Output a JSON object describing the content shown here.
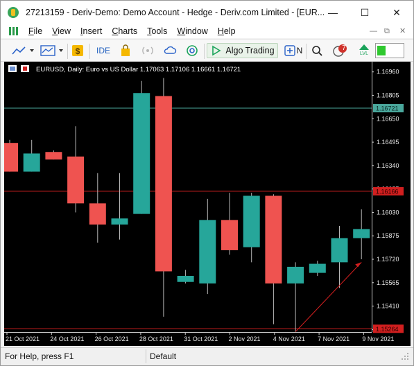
{
  "window": {
    "title": "27213159 - Deriv-Demo: Demo Account - Hedge - Deriv.com Limited - [EUR...",
    "minimize_glyph": "—",
    "maximize_glyph": "☐",
    "close_glyph": "✕"
  },
  "menu": {
    "items": [
      {
        "pre": "",
        "accel": "F",
        "post": "ile"
      },
      {
        "pre": "",
        "accel": "V",
        "post": "iew"
      },
      {
        "pre": "",
        "accel": "I",
        "post": "nsert"
      },
      {
        "pre": "",
        "accel": "C",
        "post": "harts"
      },
      {
        "pre": "",
        "accel": "T",
        "post": "ools"
      },
      {
        "pre": "",
        "accel": "W",
        "post": "indow"
      },
      {
        "pre": "",
        "accel": "H",
        "post": "elp"
      }
    ],
    "mdi_minimize": "—",
    "mdi_restore": "⧉",
    "mdi_close": "✕"
  },
  "toolbar": {
    "ide_label": "IDE",
    "algo_trading_label": "Algo Trading",
    "new_order_label": "N",
    "notification_count": "7",
    "lvl_label": "LVL"
  },
  "chart": {
    "header": "EURUSD, Daily:  Euro vs US Dollar  1.17063 1.17106 1.16661 1.16721",
    "bull_color": "#26a69a",
    "bear_color": "#ef5350",
    "price_labels": [
      "1.16960",
      "1.16805",
      "1.16650",
      "1.16495",
      "1.16340",
      "1.16185",
      "1.16030",
      "1.15875",
      "1.15720",
      "1.15565",
      "1.15410",
      "1.15255"
    ],
    "date_labels": [
      "21 Oct 2021",
      "24 Oct 2021",
      "26 Oct 2021",
      "28 Oct 2021",
      "31 Oct 2021",
      "2 Nov 2021",
      "4 Nov 2021",
      "7 Nov 2021",
      "9 Nov 2021"
    ],
    "current_price_tag": "1.16721",
    "upper_line_tag": "1.16166",
    "lower_line_tag": "1.15264"
  },
  "chart_data": {
    "type": "candlestick",
    "symbol": "EURUSD",
    "timeframe": "Daily",
    "last_ohlc": {
      "open": 1.17063,
      "high": 1.17106,
      "low": 1.16661,
      "close": 1.16721
    },
    "ylim": [
      1.1522,
      1.17
    ],
    "candles": [
      {
        "open": 1.1649,
        "high": 1.1651,
        "low": 1.163,
        "close": 1.163
      },
      {
        "open": 1.163,
        "high": 1.1651,
        "low": 1.163,
        "close": 1.1642
      },
      {
        "open": 1.1643,
        "high": 1.1644,
        "low": 1.1638,
        "close": 1.1638
      },
      {
        "open": 1.164,
        "high": 1.166,
        "low": 1.1603,
        "close": 1.1609
      },
      {
        "open": 1.1609,
        "high": 1.1629,
        "low": 1.1583,
        "close": 1.1595
      },
      {
        "open": 1.1595,
        "high": 1.1629,
        "low": 1.1585,
        "close": 1.1599
      },
      {
        "open": 1.1602,
        "high": 1.169,
        "low": 1.1602,
        "close": 1.1682
      },
      {
        "open": 1.168,
        "high": 1.1692,
        "low": 1.1534,
        "close": 1.1564
      },
      {
        "open": 1.1557,
        "high": 1.1565,
        "low": 1.1556,
        "close": 1.1561
      },
      {
        "open": 1.1556,
        "high": 1.1612,
        "low": 1.1549,
        "close": 1.1598
      },
      {
        "open": 1.1598,
        "high": 1.1616,
        "low": 1.1575,
        "close": 1.1578
      },
      {
        "open": 1.158,
        "high": 1.1616,
        "low": 1.157,
        "close": 1.1614
      },
      {
        "open": 1.1614,
        "high": 1.1615,
        "low": 1.1529,
        "close": 1.1556
      },
      {
        "open": 1.1556,
        "high": 1.157,
        "low": 1.1524,
        "close": 1.1567
      },
      {
        "open": 1.1563,
        "high": 1.1571,
        "low": 1.1561,
        "close": 1.1569
      },
      {
        "open": 1.157,
        "high": 1.1594,
        "low": 1.1553,
        "close": 1.1586
      },
      {
        "open": 1.1586,
        "high": 1.1605,
        "low": 1.1572,
        "close": 1.1592
      }
    ],
    "horizontal_lines": [
      1.1672,
      1.1617,
      1.1526
    ],
    "trend_line": {
      "from": {
        "candle": 13,
        "price": 1.1524
      },
      "to": {
        "candle": 16,
        "price": 1.157
      }
    }
  }
}
